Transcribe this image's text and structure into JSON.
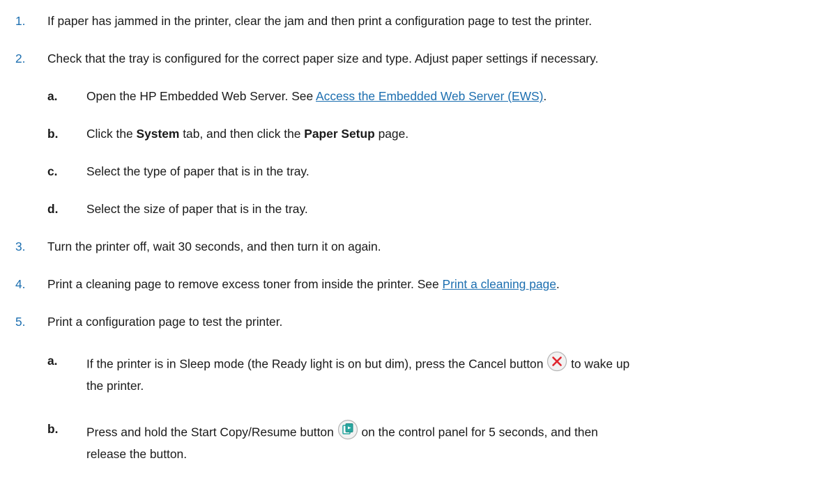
{
  "steps": [
    {
      "number": "1.",
      "text": "If paper has jammed in the printer, clear the jam and then print a configuration page to test the printer."
    },
    {
      "number": "2.",
      "text": "Check that the tray is configured for the correct paper size and type. Adjust paper settings if necessary.",
      "substeps": [
        {
          "letter": "a.",
          "before": "Open the HP Embedded Web Server. See ",
          "link": "Access the Embedded Web Server (EWS)",
          "after": "."
        },
        {
          "letter": "b.",
          "t1": "Click the ",
          "b1": "System",
          "t2": " tab, and then click the ",
          "b2": "Paper Setup",
          "t3": " page."
        },
        {
          "letter": "c.",
          "text": "Select the type of paper that is in the tray."
        },
        {
          "letter": "d.",
          "text": "Select the size of paper that is in the tray."
        }
      ]
    },
    {
      "number": "3.",
      "text": "Turn the printer off, wait 30 seconds, and then turn it on again."
    },
    {
      "number": "4.",
      "before": "Print a cleaning page to remove excess toner from inside the printer. See ",
      "link": "Print a cleaning page",
      "after": "."
    },
    {
      "number": "5.",
      "text": "Print a configuration page to test the printer.",
      "substeps": [
        {
          "letter": "a.",
          "before": "If the printer is in Sleep mode (the Ready light is on but dim), press the Cancel button ",
          "after": " to wake up",
          "line2": "the printer."
        },
        {
          "letter": "b.",
          "before": "Press and hold the Start Copy/Resume button ",
          "after": " on the control panel for 5 seconds, and then",
          "line2": "release the button."
        }
      ]
    }
  ],
  "colors": {
    "step_number": "#1d6fb0",
    "link": "#1d6fb0",
    "cancel_icon": "#e0262e",
    "resume_icon": "#2aa7a0"
  }
}
